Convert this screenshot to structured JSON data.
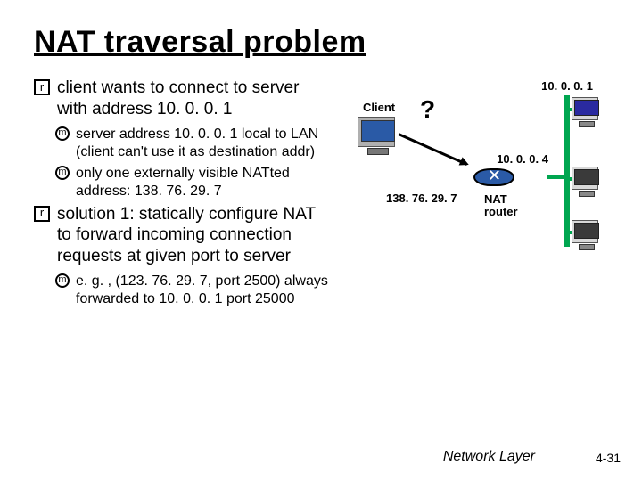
{
  "title": "NAT traversal problem",
  "bullets": {
    "r1": "client wants to connect to server with address 10. 0. 0. 1",
    "m1": "server address 10. 0. 0. 1 local to LAN (client can't use it as destination addr)",
    "m2": "only one externally visible NATted address: 138. 76. 29. 7",
    "r2": "solution 1: statically configure NAT to forward incoming connection requests at given port to server",
    "m3": "e. g. , (123. 76. 29. 7, port 2500) always forwarded to 10. 0. 0. 1 port 25000"
  },
  "diagram": {
    "client_label": "Client",
    "question": "?",
    "ip_server": "10. 0. 0. 1",
    "ip_router_lan": "10. 0. 0. 4",
    "ip_router_wan": "138. 76. 29. 7",
    "nat_label": "NAT\nrouter"
  },
  "markers": {
    "r": "r",
    "m": "m"
  },
  "footer": {
    "section": "Network Layer",
    "page": "4-31"
  }
}
